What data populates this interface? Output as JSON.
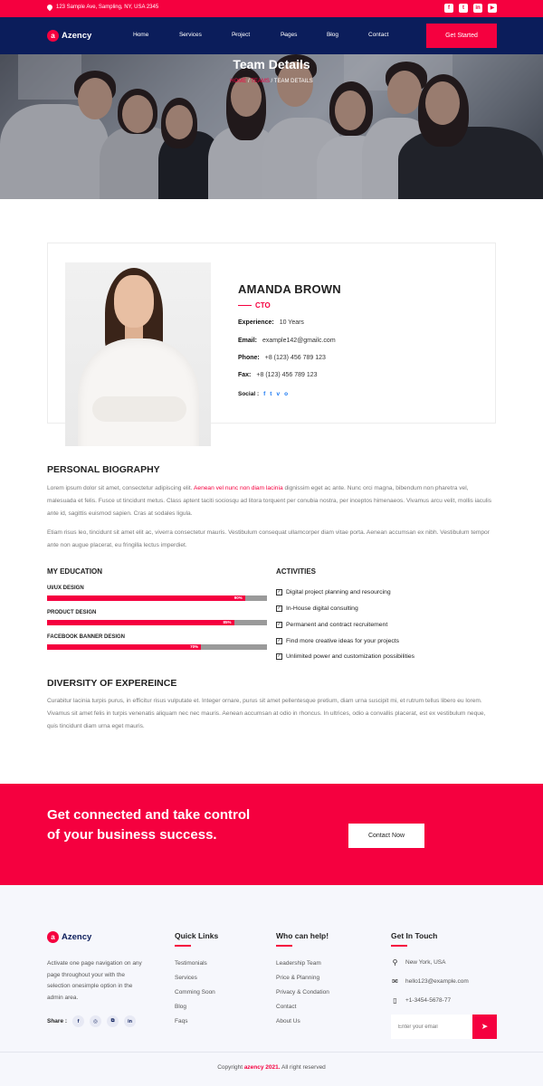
{
  "topbar": {
    "address": "123 Sample Ave, Sampling, NY, USA 2345",
    "social_icons": [
      "facebook-icon",
      "twitter-icon",
      "linkedin-icon",
      "youtube-icon"
    ]
  },
  "brand": {
    "mark": "a",
    "name": "Azency"
  },
  "nav": {
    "items": [
      {
        "label": "Home",
        "dropdown": true
      },
      {
        "label": "Services",
        "dropdown": true
      },
      {
        "label": "Project",
        "dropdown": true
      },
      {
        "label": "Pages",
        "dropdown": true
      },
      {
        "label": "Blog",
        "dropdown": true
      },
      {
        "label": "Contact",
        "dropdown": false
      }
    ],
    "cta": "Get Started"
  },
  "hero": {
    "title": "Team Details",
    "breadcrumb": [
      "HOME",
      "TEAMS",
      "TEAM DETAILS"
    ],
    "separator": "/"
  },
  "profile": {
    "name": "AMANDA BROWN",
    "role": "CTO",
    "rows": [
      {
        "label": "Experience:",
        "value": "10 Years"
      },
      {
        "label": "Email:",
        "value": "example142@gmailc.com"
      },
      {
        "label": "Phone:",
        "value": "+8 (123) 456 789 123"
      },
      {
        "label": "Fax:",
        "value": "+8 (123) 456 789 123"
      }
    ],
    "social_label": "Social :",
    "social": [
      "f",
      "t",
      "v",
      "o"
    ]
  },
  "biography": {
    "title": "PERSONAL BIOGRAPHY",
    "p1_before": "Lorem ipsum dolor sit amet, consectetur adipiscing elit. ",
    "p1_highlight": "Aenean vel nunc non diam lacinia",
    "p1_after": " dignissim eget ac ante. Nunc orci magna, bibendum non pharetra vel, malesuada et felis. Fusce ut tincidunt metus. Class aptent taciti sociosqu ad litora torquent per conubia nostra, per inceptos himenaeos. Vivamus arcu velit, mollis iaculis ante id, sagittis euismod sapien. Cras at sodales ligula.",
    "p2": "Etiam risus leo, tincidunt sit amet elit ac, viverra consectetur mauris. Vestibulum consequat ullamcorper diam vitae porta. Aenean accumsan ex nibh. Vestibulum tempor ante non augue placerat, eu fringilla lectus imperdiet."
  },
  "education": {
    "title": "MY EDUCATION",
    "skills": [
      {
        "label": "UI/UX DESIGN",
        "percent": 90,
        "percent_label": "90%"
      },
      {
        "label": "PRODUCT DESIGN",
        "percent": 85,
        "percent_label": "85%"
      },
      {
        "label": "FACEBOOK BANNER DESIGN",
        "percent": 70,
        "percent_label": "70%"
      }
    ]
  },
  "activities": {
    "title": "ACTIVITIES",
    "items": [
      "Digital project planning and resourcing",
      "In-House digital consulting",
      "Permanent and contract recruitement",
      "Find more creative ideas for your projects",
      "Unlimited power and customization possibilities"
    ]
  },
  "diversity": {
    "title": "DIVERSITY OF EXPEREINCE",
    "text": "Curabitur lacinia turpis purus, in efficitur risus vulputate et. Integer ornare, purus sit amet pellentesque pretium, diam urna suscipit mi, et rutrum tellus libero eu lorem. Vivamus sit amet felis in turpis venenatis aliquam nec nec mauris. Aenean accumsan at odio in rhoncus. In ultrices, odio a convallis placerat, est ex vestibulum neque, quis tincidunt diam urna eget mauris."
  },
  "cta": {
    "text": "Get connected and take control of your business success.",
    "button": "Contact Now"
  },
  "footer": {
    "description": "Activate one page navigation on any page throughout your with the selection onesimple option in the admin area.",
    "share_label": "Share :",
    "share_icons": [
      "f",
      "◎",
      "⧉",
      "in"
    ],
    "quick_links": {
      "title": "Quick Links",
      "items": [
        "Testimonials",
        "Services",
        "Comming Soon",
        "Blog",
        "Faqs"
      ]
    },
    "who_can_help": {
      "title": "Who can help!",
      "items": [
        "Leadership Team",
        "Price & Planning",
        "Privacy & Condation",
        "Contact",
        "About Us"
      ]
    },
    "get_in_touch": {
      "title": "Get In Touch",
      "address": "New York, USA",
      "email": "hello123@example.com",
      "phone": "+1-3454-5678-77",
      "email_placeholder": "Enter your email"
    },
    "copyright_before": "Copyright ",
    "copyright_brand": "azency 2021.",
    "copyright_after": " All right reserved"
  },
  "colors": {
    "accent": "#f5003f",
    "navy": "#0b1d5b"
  }
}
